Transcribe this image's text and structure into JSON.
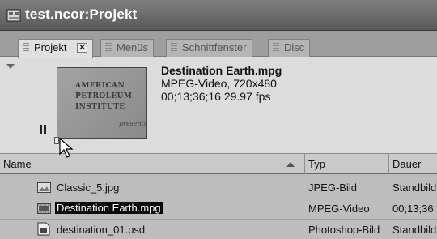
{
  "window": {
    "title": "test.ncor:Projekt"
  },
  "tabs": [
    {
      "label": "Projekt",
      "active": true,
      "close": "✕"
    },
    {
      "label": "Menüs",
      "active": false
    },
    {
      "label": "Schnittfenster",
      "active": false
    },
    {
      "label": "Disc",
      "active": false
    }
  ],
  "preview": {
    "clip_name": "Destination Earth.mpg",
    "format": "MPEG-Video, 720x480",
    "duration_fps": "00;13;36;16 29.97 fps",
    "thumbnail_lines": [
      "AMERICAN",
      "PETROLEUM",
      "INSTITUTE"
    ],
    "thumbnail_script": "presents",
    "playhead_fraction": 0.0
  },
  "columns": {
    "name": "Name",
    "type": "Typ",
    "duration": "Dauer"
  },
  "rows": [
    {
      "name": "Classic_5.jpg",
      "type": "JPEG-Bild",
      "duration": "Standbild",
      "icon": "image-file-icon",
      "selected": false
    },
    {
      "name": "Destination Earth.mpg",
      "type": "MPEG-Video",
      "duration": "00;13;36",
      "icon": "video-file-icon",
      "selected": true
    },
    {
      "name": "destination_01.psd",
      "type": "Photoshop-Bild",
      "duration": "Standbild",
      "icon": "photoshop-file-icon",
      "selected": false
    }
  ]
}
